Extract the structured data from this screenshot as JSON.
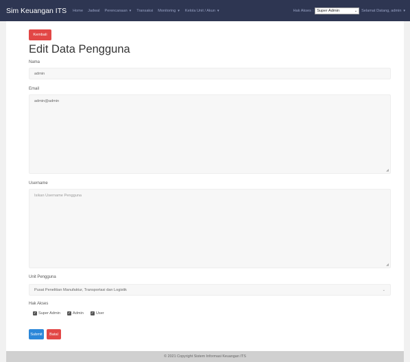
{
  "navbar": {
    "brand": "Sim Keuangan ITS",
    "links": [
      {
        "label": "Home",
        "dropdown": false
      },
      {
        "label": "Jadwal",
        "dropdown": false
      },
      {
        "label": "Perencanaan",
        "dropdown": true
      },
      {
        "label": "Transaksi",
        "dropdown": false
      },
      {
        "label": "Monitoring",
        "dropdown": true
      },
      {
        "label": "Kelola Unit / Akun",
        "dropdown": true
      }
    ],
    "access_label": "Hak Akses :",
    "access_value": "Super Admin",
    "welcome": "Selamat Datang, admin"
  },
  "form": {
    "back_label": "Kembali",
    "title": "Edit Data Pengguna",
    "name_label": "Nama",
    "name_value": "admin",
    "email_label": "Email",
    "email_value": "admin@admin",
    "username_label": "Username",
    "username_placeholder": "Isikan Username Pengguna",
    "unit_label": "Unit Pengguna",
    "unit_value": "Pusat Penelitian Manufaktur, Transportasi dan Logistik",
    "access_label": "Hak Akses",
    "access_options": [
      {
        "label": "Super Admin",
        "checked": true
      },
      {
        "label": "Admin",
        "checked": true
      },
      {
        "label": "User",
        "checked": true
      }
    ],
    "submit_label": "Submit",
    "cancel_label": "Batal"
  },
  "footer": {
    "text": "© 2021 Copyright Sistem Informasi Keuangan ITS"
  },
  "colors": {
    "navbar": "#2e3652",
    "danger": "#e24746",
    "primary": "#2b87d9"
  }
}
